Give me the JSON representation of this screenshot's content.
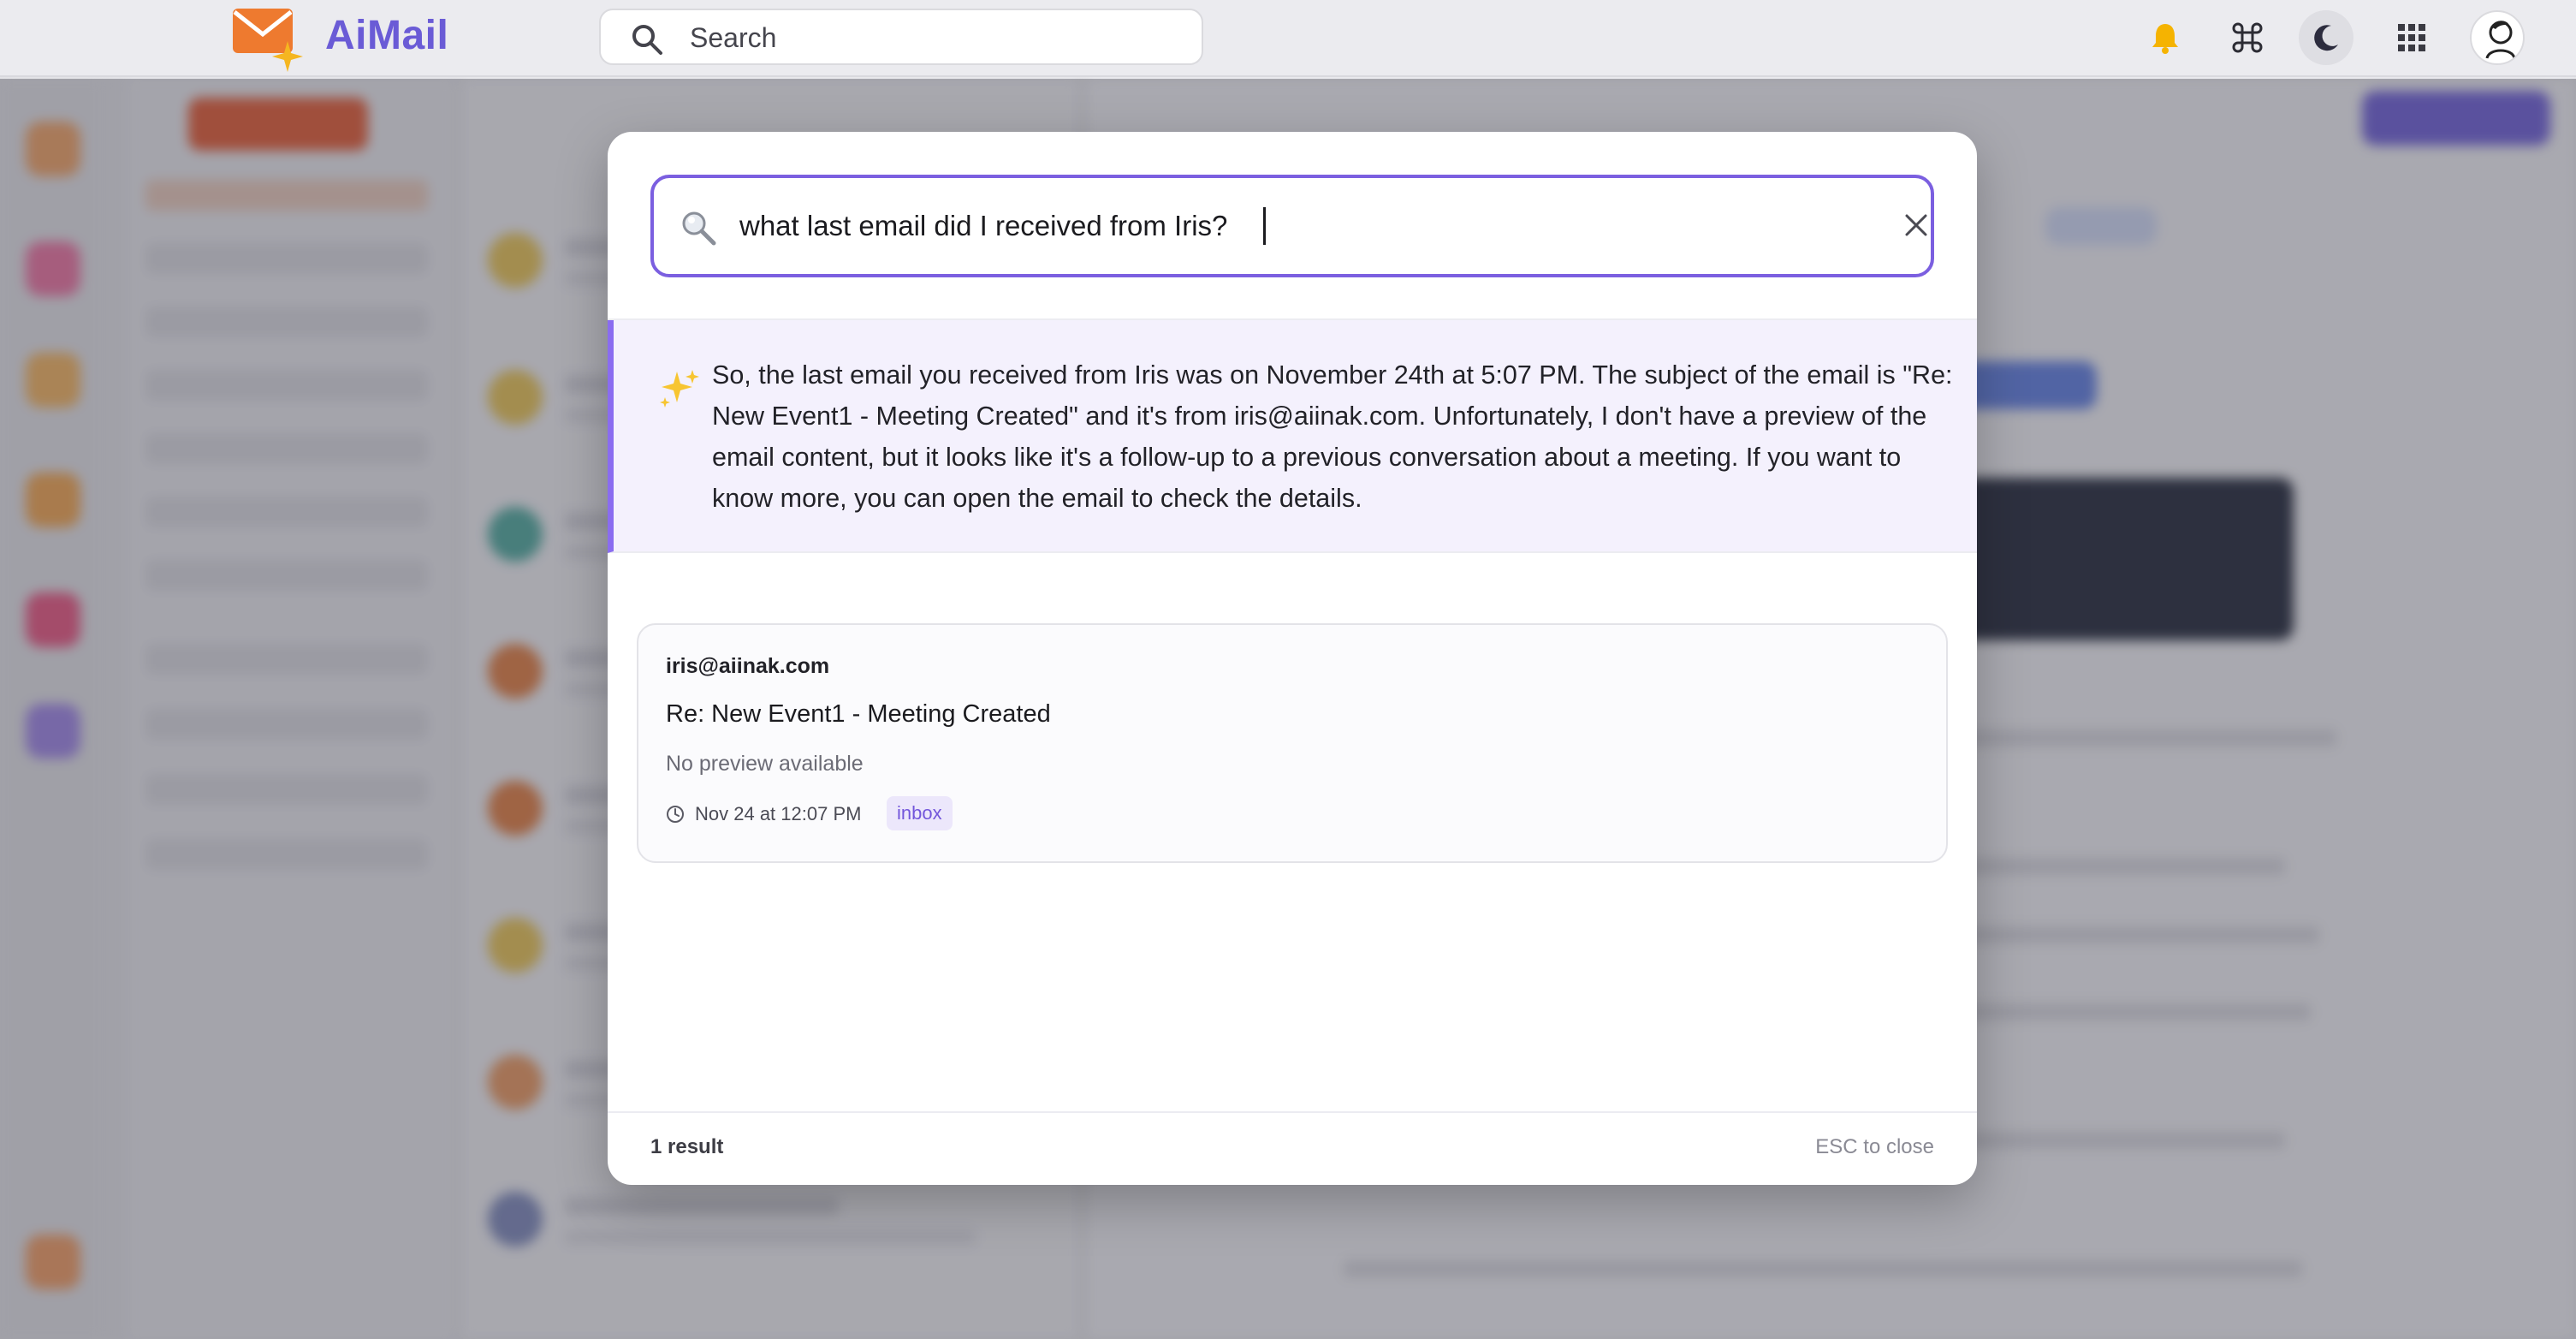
{
  "header": {
    "brand": "AiMail",
    "search_placeholder": "Search",
    "icons": [
      "bell-icon",
      "command-icon",
      "moon-icon",
      "apps-grid-icon",
      "avatar"
    ]
  },
  "search_modal": {
    "query": "what last email did I received from Iris?",
    "ai_answer": "So, the last email you received from Iris was on November 24th at 5:07 PM. The subject of the email is \"Re: New Event1 - Meeting Created\" and it's from iris@aiinak.com. Unfortunately, I don't have a preview of the email content, but it looks like it's a follow-up to a previous conversation about a meeting. If you want to know more, you can open the email to check the details.",
    "results": [
      {
        "from": "iris@aiinak.com",
        "subject": "Re: New Event1 - Meeting Created",
        "preview": "No preview available",
        "date": "Nov 24 at 12:07 PM",
        "folder": "inbox"
      }
    ],
    "result_count": "1 result",
    "close_hint": "ESC to close"
  },
  "colors": {
    "brand": "#6a5bd6",
    "accent": "#7b5fe0",
    "compose": "#e2562e",
    "bell": "#f5b301"
  }
}
